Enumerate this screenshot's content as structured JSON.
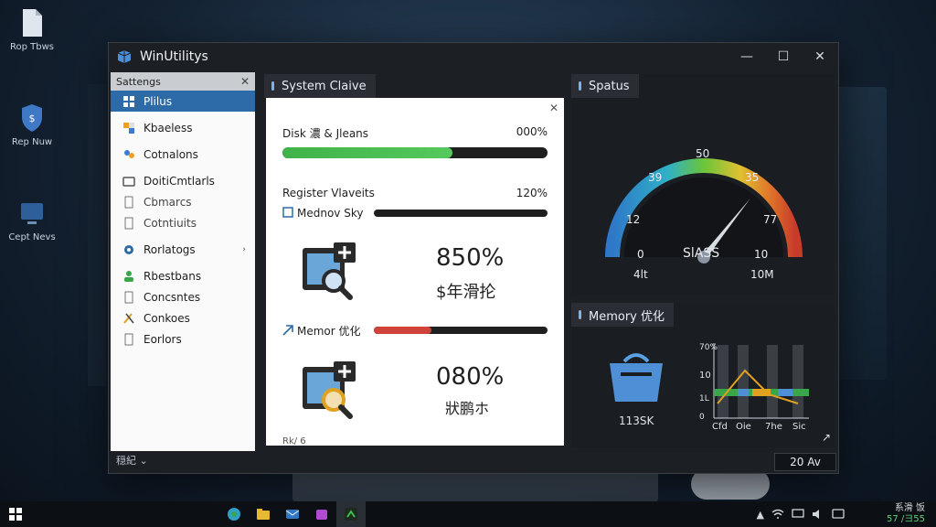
{
  "desktop": {
    "icons": [
      {
        "label": "Rop Tbws"
      },
      {
        "label": "Rep Nuw"
      },
      {
        "label": "Cept Nevs"
      }
    ]
  },
  "window": {
    "title": "WinUtilitys",
    "controls": {
      "minimize": "—",
      "maximize": "☐",
      "close": "✕"
    }
  },
  "sidebar": {
    "header": "Sattengs",
    "header_close": "✕",
    "items": [
      {
        "label": "Plilus",
        "active": true
      },
      {
        "label": "Kbaeless"
      },
      {
        "label": "Cotnalons"
      },
      {
        "label": "DoitiCmtlarls"
      },
      {
        "label": "Cbmarcs"
      },
      {
        "label": "Cotntiuits"
      },
      {
        "label": "Rorlatogs",
        "arrow": "›"
      },
      {
        "label": "Rbestbans"
      },
      {
        "label": "Concsntes"
      },
      {
        "label": "Conkoes"
      },
      {
        "label": "Eorlors"
      }
    ],
    "footer": "穏紀 ⌄"
  },
  "system_panel": {
    "tab": "System Claive",
    "close": "✕",
    "disk_label": "Disk 濃 & Jleans",
    "disk_value": "000%",
    "disk_fill": 0.64,
    "register_label": "Register Vlaveits",
    "register_value": "120%",
    "memory_sky_label": "Mednov Sky",
    "memory_sky_fill": 0.0,
    "big1_pct": "850%",
    "big1_sub": "$年滑抡",
    "memor_label": "Memor 优化",
    "memor_fill": 0.33,
    "big2_pct": "080%",
    "big2_sub": "狀鹏ホ",
    "bottom_cut": "Rk/ 6"
  },
  "status_panel": {
    "tab": "Spatus",
    "gauge": {
      "top": "50",
      "left_upper": "39",
      "right_upper": "35",
      "left_mid": "12",
      "right_mid": "77",
      "left_low": "0",
      "right_low": "10",
      "min": "4lt",
      "max": "10M",
      "center": "SlASS",
      "level": 0.66
    }
  },
  "memory_panel": {
    "tab": "Memory 优化",
    "caption": "113SK",
    "chart_ticks": {
      "top": "70%",
      "mid": "10",
      "low": "1L",
      "zero": "0"
    },
    "chart_x": [
      "Cfd",
      "Oie",
      "7he",
      "Sic"
    ],
    "expand": "↗"
  },
  "status_chip": "20 Av",
  "taskbar": {
    "tray_arrow": "▲",
    "clock_line1": "系滑 饭",
    "clock_line2": "57 /ヨ55"
  }
}
